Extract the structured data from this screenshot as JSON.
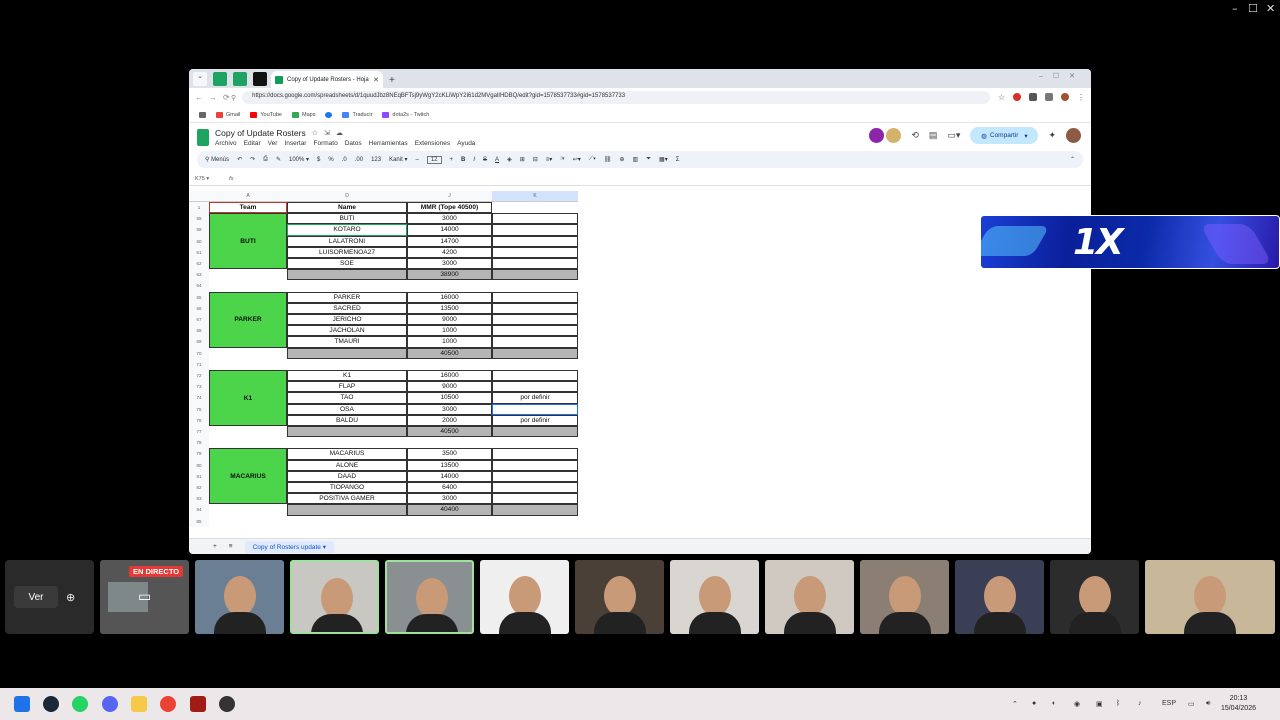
{
  "window_controls": [
    "–",
    "☐",
    "✕"
  ],
  "browser": {
    "tab_title": "Copy of Update Rosters - Hoja",
    "url": "https://docs.google.com/spreadsheets/d/1quudJbz8NEqBFTsj9yWgY2cKLiWpY2i61d2MVgalIHDBQ/edit?gid=1578537733#gid=1578537733",
    "bookmarks": [
      "Gmail",
      "YouTube",
      "Maps",
      "Traducir",
      "dota2s - Twitch"
    ]
  },
  "sheets": {
    "doc_title": "Copy of Update Rosters",
    "menu": [
      "Archivo",
      "Editar",
      "Ver",
      "Insertar",
      "Formato",
      "Datos",
      "Herramientas",
      "Extensiones",
      "Ayuda"
    ],
    "share_label": "Compartir",
    "toolbar": {
      "search": "Menús",
      "zoom": "100%",
      "font": "Kanit",
      "font_size": "12",
      "currency": "$",
      "percent": "%",
      "dec1": ".0",
      "dec2": ".00",
      "fmt": "123"
    },
    "cell_ref": "K75",
    "fx": "fx",
    "col_letters": [
      "A",
      "D",
      "J",
      "K"
    ],
    "headers": {
      "team": "Team",
      "name": "Name",
      "mmr": "MMR (Tope 40500)"
    },
    "sheet_tab": "Copy of Rosters update"
  },
  "rows": [
    {
      "n": "1",
      "type": "header"
    },
    {
      "n": "58",
      "name": "BUTI",
      "mmr": "3000",
      "k": ""
    },
    {
      "n": "59",
      "name": "KOTARO",
      "mmr": "14000",
      "k": ""
    },
    {
      "n": "60",
      "name": "LALATRONI",
      "mmr": "14700",
      "k": ""
    },
    {
      "n": "61",
      "name": "LUISORMENOA27",
      "mmr": "4200",
      "k": ""
    },
    {
      "n": "62",
      "name": "SOE",
      "mmr": "3000",
      "k": ""
    },
    {
      "n": "63",
      "total": "38900"
    },
    {
      "n": "64",
      "blank": true
    },
    {
      "n": "65",
      "name": "PARKER",
      "mmr": "16000",
      "k": ""
    },
    {
      "n": "66",
      "name": "SACRED",
      "mmr": "13500",
      "k": ""
    },
    {
      "n": "67",
      "name": "JERICHO",
      "mmr": "9000",
      "k": ""
    },
    {
      "n": "68",
      "name": "JACHOLAN",
      "mmr": "1000",
      "k": ""
    },
    {
      "n": "69",
      "name": "TMAURI",
      "mmr": "1000",
      "k": ""
    },
    {
      "n": "70",
      "total": "40500"
    },
    {
      "n": "71",
      "blank": true
    },
    {
      "n": "72",
      "name": "K1",
      "mmr": "16000",
      "k": ""
    },
    {
      "n": "73",
      "name": "FLAP",
      "mmr": "9000",
      "k": ""
    },
    {
      "n": "74",
      "name": "TAO",
      "mmr": "10500",
      "k": "por definir"
    },
    {
      "n": "75",
      "name": "OSA",
      "mmr": "3000",
      "k": ""
    },
    {
      "n": "76",
      "name": "BALDU",
      "mmr": "2000",
      "k": "por definir"
    },
    {
      "n": "77",
      "total": "40500"
    },
    {
      "n": "78",
      "blank": true
    },
    {
      "n": "79",
      "name": "MACARIUS",
      "mmr": "3500",
      "k": ""
    },
    {
      "n": "80",
      "name": "ALONE",
      "mmr": "13500",
      "k": ""
    },
    {
      "n": "81",
      "name": "DAAD",
      "mmr": "14000",
      "k": ""
    },
    {
      "n": "82",
      "name": "TIOPANGO",
      "mmr": "6400",
      "k": ""
    },
    {
      "n": "83",
      "name": "POSITIVA GAMER",
      "mmr": "3000",
      "k": ""
    },
    {
      "n": "84",
      "total": "40400"
    },
    {
      "n": "85",
      "blank": true
    }
  ],
  "teams": [
    {
      "name": "BUTI",
      "first_row": 1,
      "span": 5
    },
    {
      "name": "PARKER",
      "first_row": 8,
      "span": 5
    },
    {
      "name": "K1",
      "first_row": 15,
      "span": 5
    },
    {
      "name": "MACARIUS",
      "first_row": 22,
      "span": 5
    }
  ],
  "overlay": {
    "sponsor": "1X"
  },
  "call": {
    "view_button": "Ver",
    "live_badge": "EN DIRECTO"
  },
  "taskbar": {
    "lang": "ESP",
    "time": "20:13",
    "date": "15/04/2026"
  }
}
